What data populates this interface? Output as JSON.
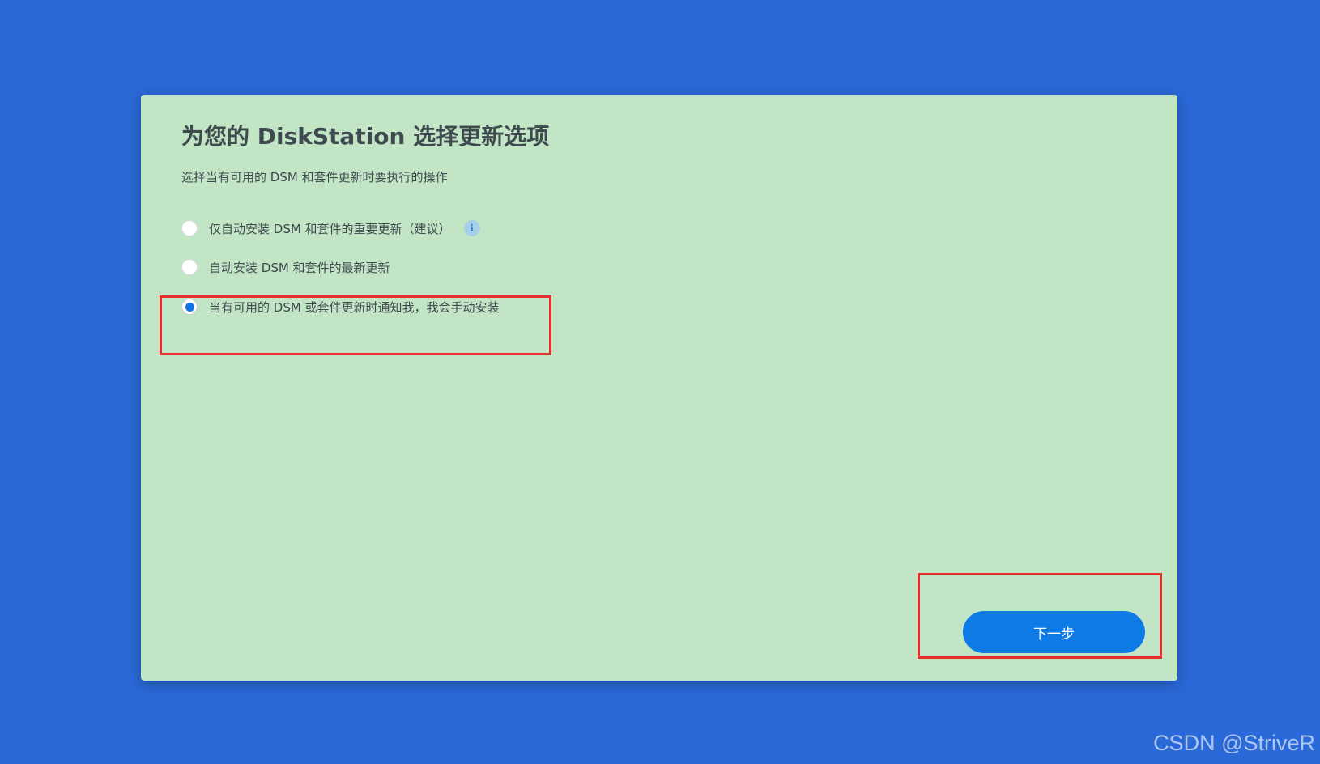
{
  "dialog": {
    "title": "为您的 DiskStation 选择更新选项",
    "subtitle": "选择当有可用的 DSM 和套件更新时要执行的操作",
    "options": [
      {
        "label": "仅自动安装 DSM 和套件的重要更新（建议）",
        "selected": false,
        "has_info_icon": true
      },
      {
        "label": "自动安装 DSM 和套件的最新更新",
        "selected": false
      },
      {
        "label": "当有可用的 DSM 或套件更新时通知我，我会手动安装",
        "selected": true
      }
    ],
    "info_icon_glyph": "i",
    "next_button_label": "下一步"
  },
  "watermark": "CSDN @StriveR",
  "colors": {
    "background": "#2a69d8",
    "dialog": "#c2e6c5",
    "accent": "#0d7ae5",
    "highlight": "#e62e2e",
    "text": "#3f4a4f"
  }
}
